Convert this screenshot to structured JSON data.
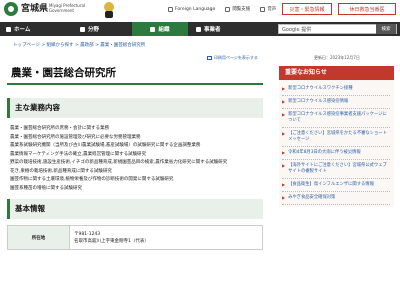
{
  "header": {
    "logo_text": "宮城県",
    "logo_sub": "Miyagi Prefectural Government",
    "util_links": [
      "Foreign Language",
      "閲覧支援",
      "音声"
    ],
    "disaster_button": "災害・緊急情報",
    "mobile_button": "休日救急当番医"
  },
  "nav": {
    "items": [
      "ホーム",
      "組織",
      "分野",
      "事業者"
    ],
    "search_placeholder": "Google 提供",
    "search_button": "検索"
  },
  "breadcrumb": "トップページ > 組織から探す > 農政部 > 農業・園芸総合研究所",
  "meta": {
    "mail_label": "印刷用ページを表示する",
    "share_label": "掲載日",
    "date_label": "更新日：2023年12月7日"
  },
  "main": {
    "title": "農業・園芸総合研究所",
    "duties_heading": "主な業務内容",
    "duties": [
      "農業・園芸総合研究所の庶務・会計に関する業務",
      "農業・園芸総合研究所の施設管理及び研究に必要な労務管理業務",
      "農業系試験研究機関（当所及び古川農業試験場,畜産試験場）の試験研究に関する企画調整業務",
      "農業情報マーケティング手法の確立,農業経営管理に関する試験研究",
      "野菜の栽培技術,施設生産技術,イチゴの新品種育成,新規園芸品目の検索,農作業省力化研究に関する試験研究",
      "花き,果樹の栽培技術,新品種育成に関する試験研究",
      "園芸作物に関する土壌環境,植物栄養及び作物の診断技術の開発に関する試験研究",
      "園芸系種苗の増殖に関する試験研究"
    ],
    "basic_heading": "基本情報",
    "info_label": "所在地",
    "info_lines": [
      "〒981-1243",
      "名取市高舘川上字東金剛寺1（代表）"
    ]
  },
  "sidebar": {
    "heading": "重要なお知らせ",
    "items": [
      "新型コロナウイルスワクチン接種",
      "新型コロナウイルス感染症情報",
      "新型コロナウイルス感染症事業者支援パッケージについて",
      "【ご注意ください】宮城県をかたる不審なショートメッセージ",
      "令和4年8月3日の大雨に伴う被災情報",
      "【海外サイトにご注意ください】宮城県公式ウェブサイトの複製サイト",
      "【食品衛生】鳥インフルエンザに関する情報",
      "みやぎ食品安全確保対策"
    ]
  }
}
